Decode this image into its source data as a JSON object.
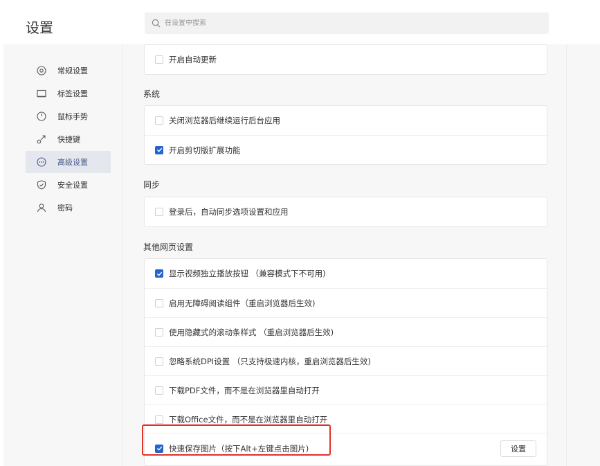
{
  "header": {
    "title": "设置",
    "search_placeholder": "在设置中搜索"
  },
  "sidebar": {
    "items": [
      {
        "label": "常规设置",
        "icon": "general-settings-icon",
        "active": false
      },
      {
        "label": "标签设置",
        "icon": "tab-settings-icon",
        "active": false
      },
      {
        "label": "鼠标手势",
        "icon": "mouse-gesture-icon",
        "active": false
      },
      {
        "label": "快捷键",
        "icon": "shortcut-icon",
        "active": false
      },
      {
        "label": "高级设置",
        "icon": "advanced-settings-icon",
        "active": true
      },
      {
        "label": "安全设置",
        "icon": "security-shield-icon",
        "active": false
      },
      {
        "label": "密码",
        "icon": "user-password-icon",
        "active": false
      }
    ]
  },
  "sections": {
    "top": {
      "items": [
        {
          "label": "开启自动更新",
          "checked": false
        }
      ]
    },
    "system": {
      "title": "系统",
      "items": [
        {
          "label": "关闭浏览器后继续运行后台应用",
          "checked": false
        },
        {
          "label": "开启剪切版扩展功能",
          "checked": true
        }
      ]
    },
    "sync": {
      "title": "同步",
      "items": [
        {
          "label": "登录后，自动同步选项设置和应用",
          "checked": false
        }
      ]
    },
    "other": {
      "title": "其他网页设置",
      "items": [
        {
          "label": "显示视频独立播放按钮 （兼容模式下不可用)",
          "checked": true
        },
        {
          "label": "启用无障碍阅读组件（重启浏览器后生效)",
          "checked": false
        },
        {
          "label": "使用隐藏式的滚动条样式 （重启浏览器后生效)",
          "checked": false
        },
        {
          "label": "忽略系统DPI设置 （只支持极速内核，重启浏览器后生效)",
          "checked": false
        },
        {
          "label": "下载PDF文件，而不是在浏览器里自动打开",
          "checked": false
        },
        {
          "label": "下载Office文件，而不是在浏览器里自动打开",
          "checked": false
        },
        {
          "label": "快速保存图片（按下Alt+左键点击图片)",
          "checked": true,
          "button": "设置"
        }
      ]
    }
  },
  "colors": {
    "accent": "#2266cc",
    "highlight_border": "#e0302a",
    "active_nav_bg": "#e4e7ee"
  }
}
